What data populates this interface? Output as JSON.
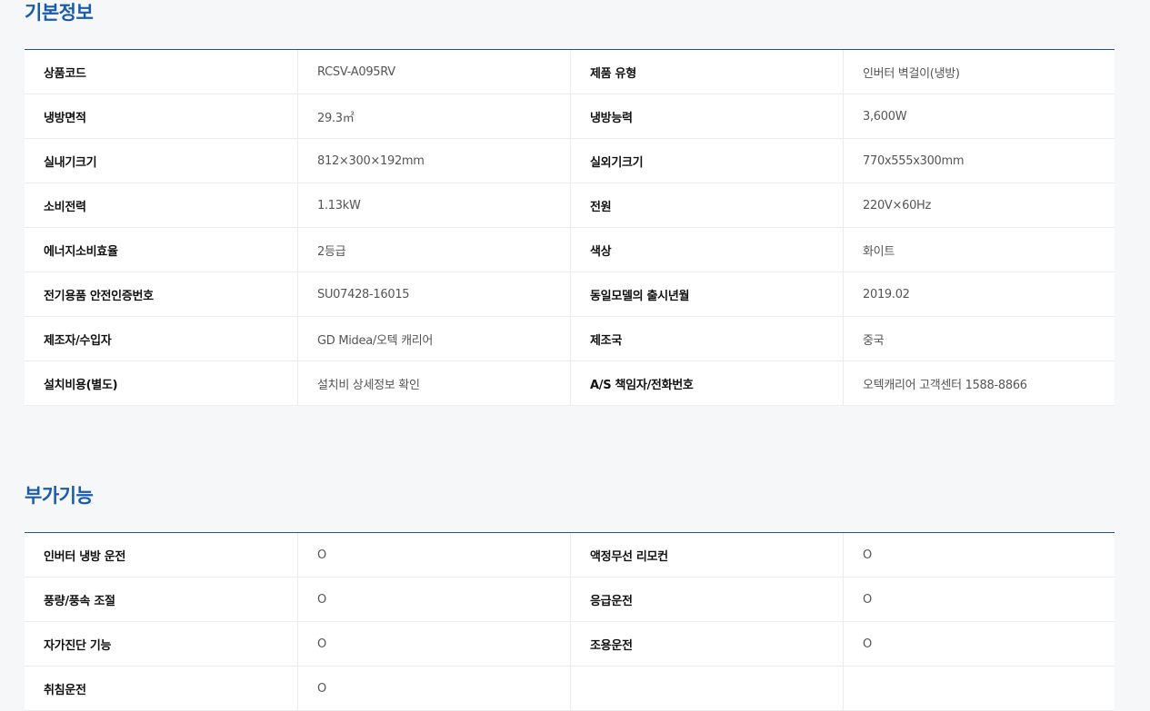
{
  "basic": {
    "title": "기본정보",
    "rows": [
      [
        "상품코드",
        "RCSV-A095RV",
        "제품 유형",
        "인버터 벽걸이(냉방)"
      ],
      [
        "냉방면적",
        "29.3㎡",
        "냉방능력",
        "3,600W"
      ],
      [
        "실내기크기",
        "812×300×192mm",
        "실외기크기",
        "770x555x300mm"
      ],
      [
        "소비전력",
        "1.13kW",
        "전원",
        "220V×60Hz"
      ],
      [
        "에너지소비효율",
        "2등급",
        "색상",
        "화이트"
      ],
      [
        "전기용품 안전인증번호",
        "SU07428-16015",
        "동일모델의 출시년월",
        "2019.02"
      ],
      [
        "제조자/수입자",
        "GD Midea/오텍 캐리어",
        "제조국",
        "중국"
      ],
      [
        "설치비용(별도)",
        "설치비 상세정보 확인",
        "A/S 책임자/전화번호",
        "오텍캐리어 고객센터 1588-8866"
      ]
    ]
  },
  "extra": {
    "title": "부가기능",
    "rows": [
      [
        "인버터 냉방 운전",
        "O",
        "액정무선 리모컨",
        "O"
      ],
      [
        "풍량/풍속 조절",
        "O",
        "응급운전",
        "O"
      ],
      [
        "자가진단 기능",
        "O",
        "조용운전",
        "O"
      ],
      [
        "취침운전",
        "O",
        "",
        ""
      ]
    ]
  }
}
